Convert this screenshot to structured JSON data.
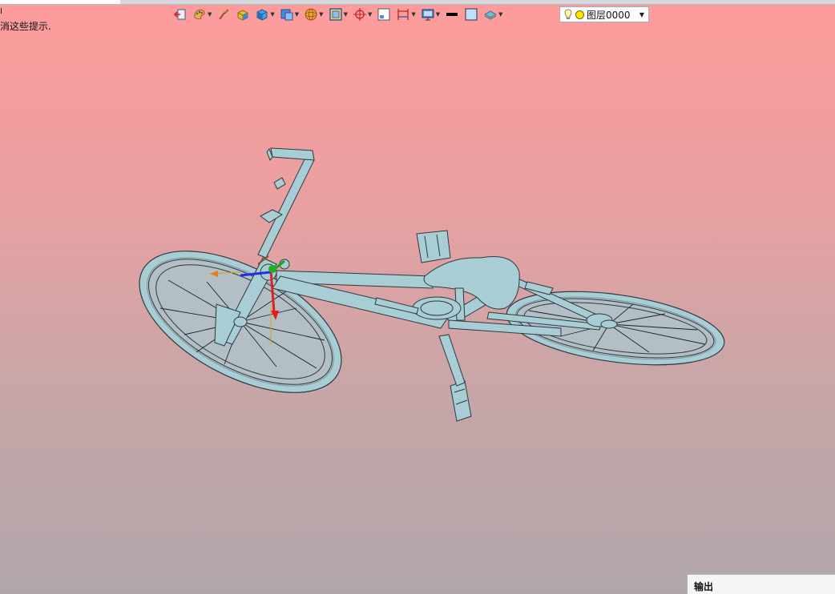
{
  "hint": {
    "mark": "Ⅰ",
    "text": "消这些提示."
  },
  "toolbar": {
    "items": [
      {
        "name": "exit-icon",
        "dropdown": false
      },
      {
        "name": "paint-icon",
        "dropdown": true
      },
      {
        "name": "brush-icon",
        "dropdown": false
      },
      {
        "name": "solid-box-icon",
        "dropdown": false
      },
      {
        "name": "cube-icon",
        "dropdown": true
      },
      {
        "name": "view-cube-icon",
        "dropdown": true
      },
      {
        "name": "sphere-icon",
        "dropdown": true
      },
      {
        "name": "frame-icon",
        "dropdown": true
      },
      {
        "name": "crosshair-icon",
        "dropdown": true
      },
      {
        "name": "window-icon",
        "dropdown": false
      },
      {
        "name": "dimension-icon",
        "dropdown": true
      },
      {
        "name": "display-icon",
        "dropdown": true
      },
      {
        "name": "line-color-icon",
        "dropdown": false
      },
      {
        "name": "fill-color-icon",
        "dropdown": false
      },
      {
        "name": "layer-stack-icon",
        "dropdown": true
      }
    ]
  },
  "layer": {
    "current": "图层0000",
    "colors": {
      "sun": "#ffe600"
    }
  },
  "output_panel": {
    "title": "输出"
  },
  "colors": {
    "background_top": "#ff9c9c",
    "background_bottom": "#b0a6aa",
    "model": "#a8cdd4"
  }
}
